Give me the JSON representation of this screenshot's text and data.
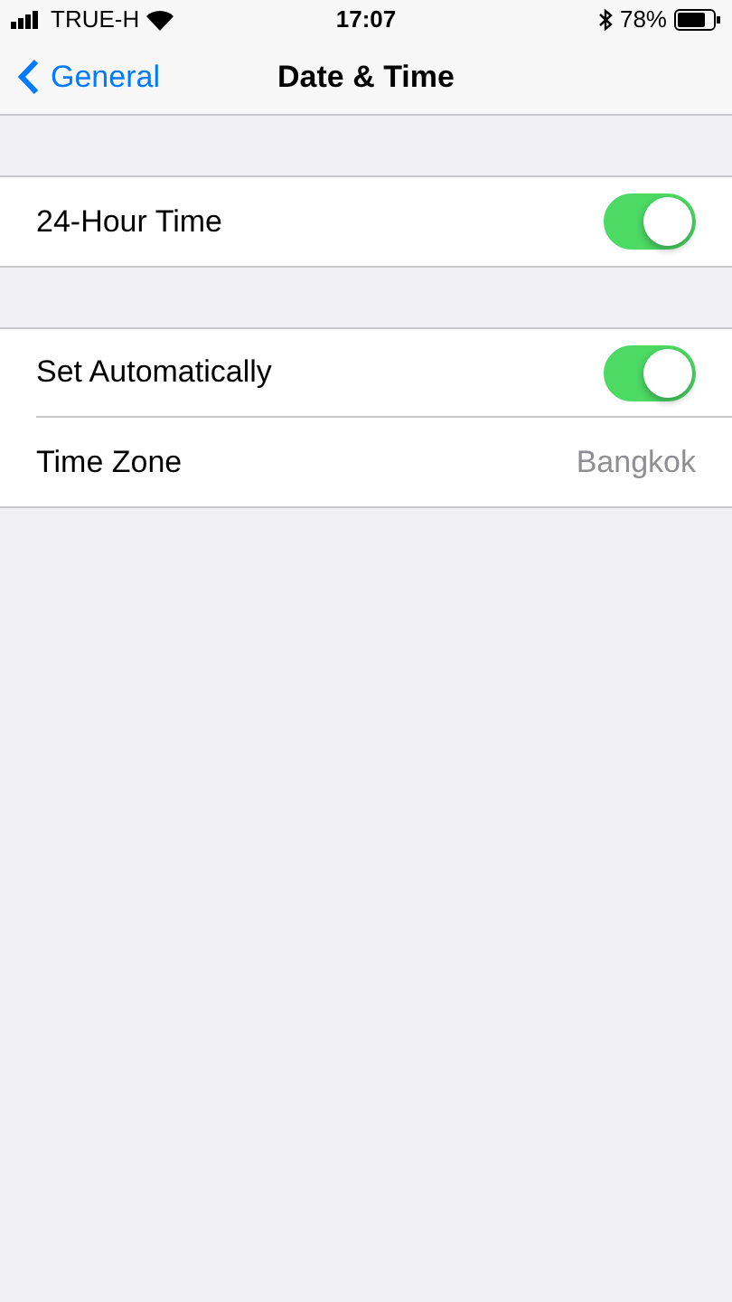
{
  "status_bar": {
    "carrier": "TRUE-H",
    "time": "17:07",
    "battery": "78%"
  },
  "nav": {
    "back": "General",
    "title": "Date & Time"
  },
  "groups": [
    {
      "rows": [
        {
          "kind": "toggle",
          "label": "24-Hour Time",
          "on": true
        }
      ]
    },
    {
      "rows": [
        {
          "kind": "toggle",
          "label": "Set Automatically",
          "on": true
        },
        {
          "kind": "value",
          "label": "Time Zone",
          "value": "Bangkok"
        }
      ]
    }
  ]
}
